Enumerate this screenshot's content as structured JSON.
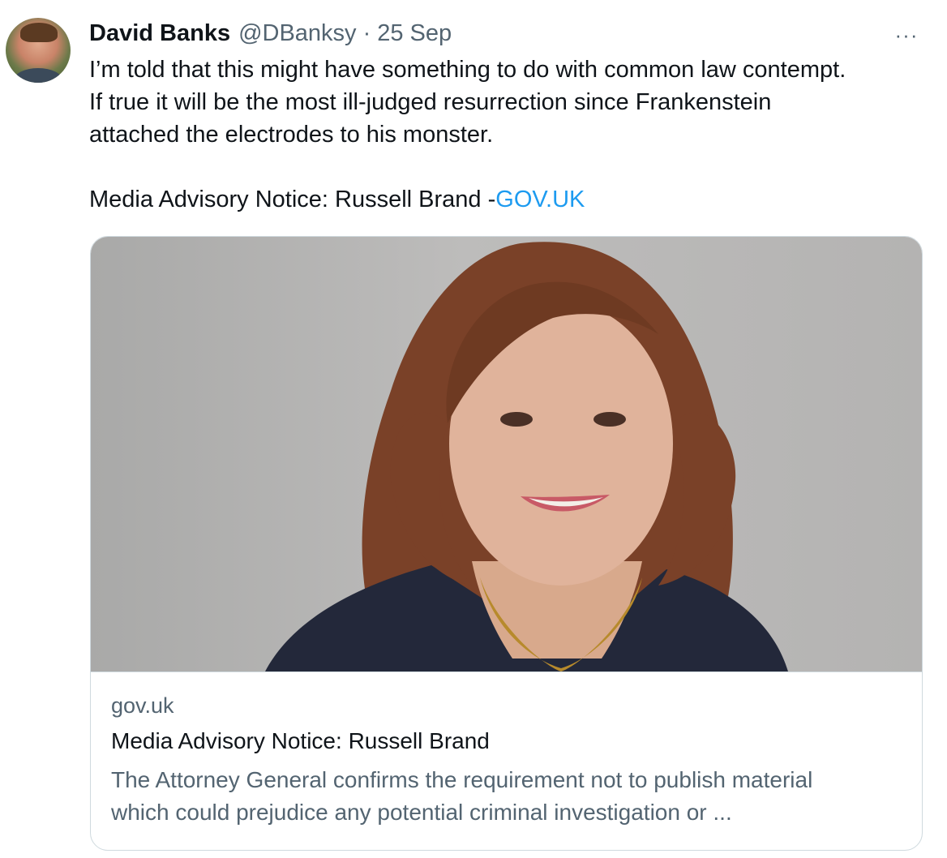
{
  "tweet": {
    "author_name": "David Banks",
    "author_handle": "@DBanksy",
    "separator": "·",
    "date": "25 Sep",
    "more_label": "···",
    "text_lines": [
      "I’m told that this might have something to do with common law contempt.",
      "If true it will be the most ill-judged resurrection since Frankenstein",
      "attached the electrodes to his monster."
    ],
    "link_prefix": "Media Advisory Notice: Russell Brand -",
    "link_text": "GOV.UK"
  },
  "card": {
    "domain": "gov.uk",
    "title": "Media Advisory Notice: Russell Brand",
    "description_lines": [
      "The Attorney General confirms the requirement not to publish material",
      "which could prejudice any potential criminal investigation or ..."
    ]
  },
  "colors": {
    "text_primary": "#0f1419",
    "text_secondary": "#536471",
    "link": "#1d9bf0",
    "border": "#cfd9de"
  }
}
